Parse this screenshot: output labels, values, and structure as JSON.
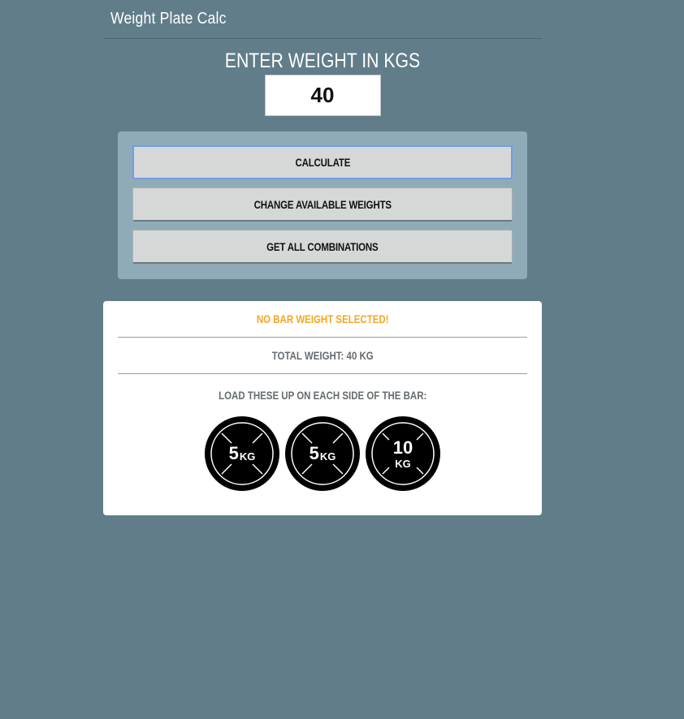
{
  "header": {
    "title": "Weight Plate Calc"
  },
  "weight_entry": {
    "label": "ENTER WEIGHT IN KGS",
    "value": "40"
  },
  "buttons": {
    "calculate": "CALCULATE",
    "change_weights": "CHANGE AVAILABLE WEIGHTS",
    "combinations": "GET ALL COMBINATIONS"
  },
  "results": {
    "bar_warning": "NO BAR WEIGHT SELECTED!",
    "total": "TOTAL WEIGHT: 40 KG",
    "instruction": "LOAD THESE UP ON EACH SIDE OF THE BAR:",
    "plates": [
      {
        "value": "5",
        "unit": "KG"
      },
      {
        "value": "5",
        "unit": "KG"
      },
      {
        "value": "10",
        "unit": "KG"
      }
    ]
  },
  "colors": {
    "background": "#617d8a",
    "panel": "#8fabb8",
    "warning": "#f5a623",
    "plate": "#000000"
  },
  "icons": {
    "plate": "weight-plate-icon"
  }
}
